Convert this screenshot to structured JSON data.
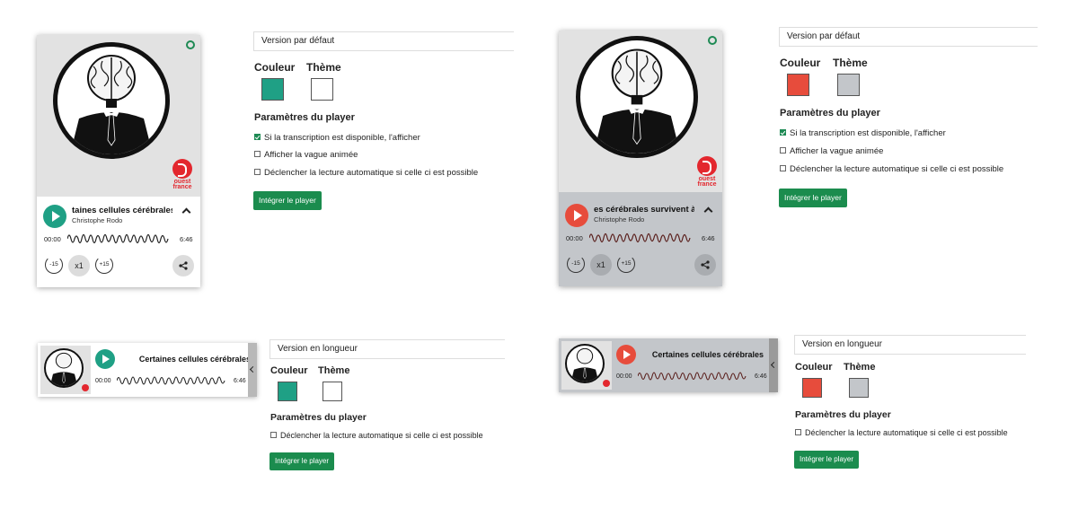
{
  "episode": {
    "title_vertical_left": "taines cellules cérébrales",
    "title_vertical_right": "es cérébrales survivent à",
    "title_horizontal": "Certaines cellules cérébrales",
    "author": "Christophe Rodo",
    "time_start": "00:00",
    "time_end": "6:46"
  },
  "player_controls": {
    "rewind_label": "-15",
    "speed_label": "x1",
    "forward_label": "+15"
  },
  "brand": {
    "logo_text": "ouest france"
  },
  "panels": {
    "default_version": {
      "select_value": "Version par défaut",
      "color_label": "Couleur",
      "theme_label": "Thème",
      "params_title": "Paramètres du player",
      "options": [
        "Si la transcription est disponible, l'afficher",
        "Afficher la vague animée",
        "Déclencher la lecture automatique si celle ci est possible"
      ],
      "embed_button": "Intégrer le player"
    },
    "long_version": {
      "select_value": "Version en longueur",
      "color_label": "Couleur",
      "theme_label": "Thème",
      "params_title": "Paramètres du player",
      "options": [
        "Déclencher la lecture automatique si celle ci est possible"
      ],
      "embed_button": "Intégrer le player"
    }
  },
  "variants": {
    "green_light": {
      "accent": "#1fa085",
      "theme": "#ffffff",
      "card_bg": "#ffffff",
      "checked": [
        true,
        false,
        false
      ]
    },
    "red_grey": {
      "accent": "#e74c3c",
      "theme": "#c3c6ca",
      "card_bg": "#c3c6ca",
      "checked": [
        true,
        false,
        false
      ]
    }
  },
  "colors": {
    "embed_button": "#1b8c4e",
    "logo_red": "#e3272e",
    "speed_btn_light": "#dcdcdc",
    "speed_btn_grey": "#a9acb0"
  },
  "icons": [
    "chat-icon",
    "play-icon",
    "chevron-up-icon",
    "rewind-15-icon",
    "forward-15-icon",
    "share-icon",
    "chevron-left-icon",
    "checkbox-icon",
    "brain-portrait-icon"
  ]
}
